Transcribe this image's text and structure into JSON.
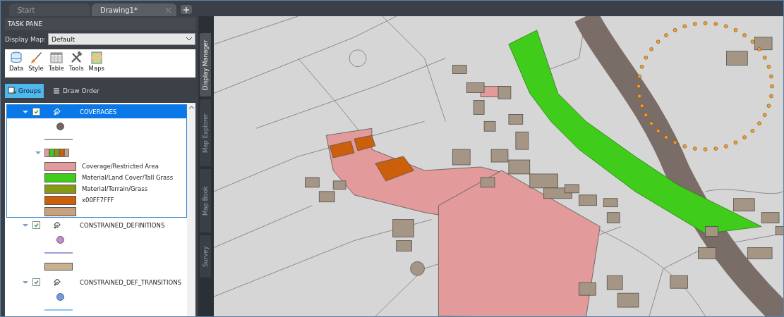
{
  "tabs": [
    {
      "label": "Start",
      "selected": false
    },
    {
      "label": "Drawing1*",
      "selected": true
    }
  ],
  "task_pane": {
    "title": "TASK PANE",
    "display_map": {
      "label": "Display Map:",
      "value": "Default"
    }
  },
  "toolbar": [
    {
      "label": "Data"
    },
    {
      "label": "Style"
    },
    {
      "label": "Table"
    },
    {
      "label": "Tools"
    },
    {
      "label": "Maps"
    }
  ],
  "view_buttons": [
    {
      "label": "Groups",
      "selected": true
    },
    {
      "label": "Draw Order",
      "selected": false
    }
  ],
  "layers": [
    {
      "name": "COVERAGES",
      "checked": true,
      "selected": true,
      "expanded": true,
      "legend": [
        {
          "kind": "point",
          "color": "#76665e"
        },
        {
          "kind": "line",
          "color": "#a0a0a0"
        },
        {
          "kind": "theme",
          "expanded": true,
          "items": [
            {
              "label": "Coverage/Restricted Area",
              "color": "#e29a9a"
            },
            {
              "label": "Material/Land Cover/Tall Grass",
              "color": "#3fcc1a"
            },
            {
              "label": "Material/Terrain/Grass",
              "color": "#859a10"
            },
            {
              "label": "x00FF7FFF",
              "color": "#cc5f0c"
            },
            {
              "color": "#c8a07c"
            }
          ]
        }
      ]
    },
    {
      "name": "CONSTRAINED_DEFINITIONS",
      "checked": true,
      "selected": false,
      "expanded": true,
      "legend": [
        {
          "kind": "point",
          "color": "#c58ad0"
        },
        {
          "kind": "line",
          "color": "#9aa0d8"
        },
        {
          "kind": "polygon",
          "color": "#c8b090"
        }
      ]
    },
    {
      "name": "CONSTRAINED_DEF_TRANSITIONS",
      "checked": true,
      "selected": false,
      "expanded": true,
      "legend": [
        {
          "kind": "point",
          "color": "#6f9ce8"
        },
        {
          "kind": "line",
          "color": "#8cc4ee"
        }
      ]
    }
  ],
  "side_tabs": [
    {
      "label": "Display Manager",
      "selected": true
    },
    {
      "label": "Map Explorer",
      "selected": false
    },
    {
      "label": "Map Book",
      "selected": false
    },
    {
      "label": "Survey",
      "selected": false
    }
  ]
}
